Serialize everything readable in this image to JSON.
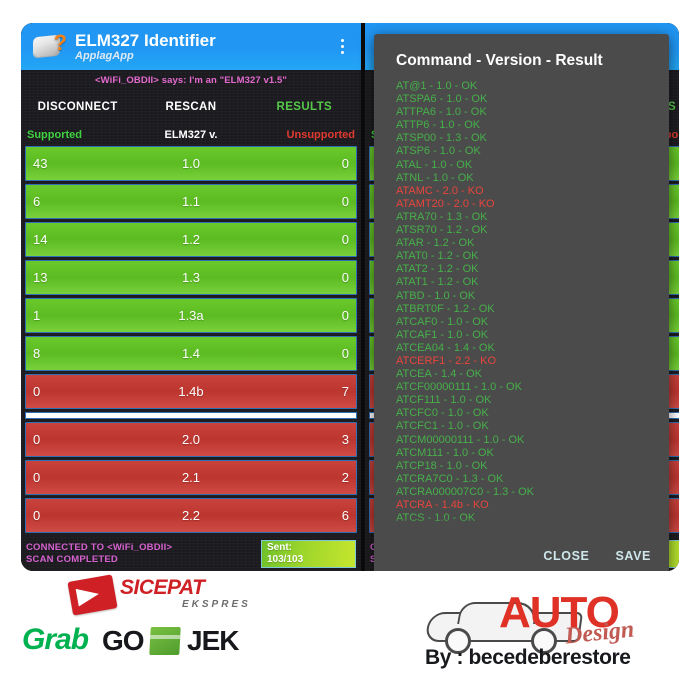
{
  "app": {
    "title": "ELM327 Identifier",
    "developer": "ApplagApp",
    "icon": "obd-connector-question-icon",
    "overflow_icon": "overflow-menu-icon",
    "says_line": "<WiFi_OBDII> says: I'm an \"ELM327 v1.5\"",
    "buttons": {
      "disconnect": "DISCONNECT",
      "rescan": "RESCAN",
      "results": "RESULTS"
    },
    "columns": {
      "supported": "Supported",
      "version": "ELM327 v.",
      "unsupported": "Unsupported"
    },
    "rows": [
      {
        "supported": "43",
        "version": "1.0",
        "unsupported": "0",
        "state": "sup"
      },
      {
        "supported": "6",
        "version": "1.1",
        "unsupported": "0",
        "state": "sup"
      },
      {
        "supported": "14",
        "version": "1.2",
        "unsupported": "0",
        "state": "sup"
      },
      {
        "supported": "13",
        "version": "1.3",
        "unsupported": "0",
        "state": "sup"
      },
      {
        "supported": "1",
        "version": "1.3a",
        "unsupported": "0",
        "state": "sup"
      },
      {
        "supported": "8",
        "version": "1.4",
        "unsupported": "0",
        "state": "sup"
      },
      {
        "supported": "0",
        "version": "1.4b",
        "unsupported": "7",
        "state": "unsup"
      },
      {
        "divider": true
      },
      {
        "supported": "0",
        "version": "2.0",
        "unsupported": "3",
        "state": "unsup"
      },
      {
        "supported": "0",
        "version": "2.1",
        "unsupported": "2",
        "state": "unsup"
      },
      {
        "supported": "0",
        "version": "2.2",
        "unsupported": "6",
        "state": "unsup"
      }
    ],
    "status": {
      "line1": "CONNECTED TO <WiFi_OBDII>",
      "line2": "SCAN COMPLETED",
      "sent_label": "Sent:",
      "sent_value": "103/103"
    },
    "colors": {
      "accent": "#2196f3",
      "supported": "#5cbb22",
      "unsupported": "#bd352f",
      "status_text": "#d661d0",
      "says_text": "#e46ad0"
    }
  },
  "dialog": {
    "title": "Command - Version - Result",
    "lines": [
      {
        "text": "AT@1 - 1.0 - OK",
        "result": "ok"
      },
      {
        "text": "ATSPA6 - 1.0 - OK",
        "result": "ok"
      },
      {
        "text": "ATTPA6 - 1.0 - OK",
        "result": "ok"
      },
      {
        "text": "ATTP6 - 1.0 - OK",
        "result": "ok"
      },
      {
        "text": "ATSP00 - 1.3 - OK",
        "result": "ok"
      },
      {
        "text": "ATSP6 - 1.0 - OK",
        "result": "ok"
      },
      {
        "text": "ATAL - 1.0 - OK",
        "result": "ok"
      },
      {
        "text": "ATNL - 1.0 - OK",
        "result": "ok"
      },
      {
        "text": "ATAMC - 2.0 - KO",
        "result": "ko"
      },
      {
        "text": "ATAMT20 - 2.0 - KO",
        "result": "ko"
      },
      {
        "text": "ATRA70 - 1.3 - OK",
        "result": "ok"
      },
      {
        "text": "ATSR70 - 1.2 - OK",
        "result": "ok"
      },
      {
        "text": "ATAR - 1.2 - OK",
        "result": "ok"
      },
      {
        "text": "ATAT0 - 1.2 - OK",
        "result": "ok"
      },
      {
        "text": "ATAT2 - 1.2 - OK",
        "result": "ok"
      },
      {
        "text": "ATAT1 - 1.2 - OK",
        "result": "ok"
      },
      {
        "text": "ATBD - 1.0 - OK",
        "result": "ok"
      },
      {
        "text": "ATBRT0F - 1.2 - OK",
        "result": "ok"
      },
      {
        "text": "ATCAF0 - 1.0 - OK",
        "result": "ok"
      },
      {
        "text": "ATCAF1 - 1.0 - OK",
        "result": "ok"
      },
      {
        "text": "ATCEA04 - 1.4 - OK",
        "result": "ok"
      },
      {
        "text": "ATCERF1 - 2.2 - KO",
        "result": "ko"
      },
      {
        "text": "ATCEA - 1.4 - OK",
        "result": "ok"
      },
      {
        "text": "ATCF00000111 - 1.0 - OK",
        "result": "ok"
      },
      {
        "text": "ATCF111 - 1.0 - OK",
        "result": "ok"
      },
      {
        "text": "ATCFC0 - 1.0 - OK",
        "result": "ok"
      },
      {
        "text": "ATCFC1 - 1.0 - OK",
        "result": "ok"
      },
      {
        "text": "ATCM00000111 - 1.0 - OK",
        "result": "ok"
      },
      {
        "text": "ATCM111 - 1.0 - OK",
        "result": "ok"
      },
      {
        "text": "ATCP18 - 1.0 - OK",
        "result": "ok"
      },
      {
        "text": "ATCRA7C0 - 1.3 - OK",
        "result": "ok"
      },
      {
        "text": "ATCRA000007C0 - 1.3 - OK",
        "result": "ok"
      },
      {
        "text": "ATCRA - 1.4b - KO",
        "result": "ko"
      },
      {
        "text": "ATCS - 1.0 - OK",
        "result": "ok"
      }
    ],
    "close_label": "CLOSE",
    "save_label": "SAVE"
  },
  "watermarks": {
    "sicepat": {
      "name": "SICEPAT",
      "sub": "EKSPRES"
    },
    "grab": "Grab",
    "gojek_go": "GO",
    "gojek_jek": "JEK",
    "auto": "AUTO",
    "design": "Design",
    "byline": "By : becedeberestore"
  }
}
